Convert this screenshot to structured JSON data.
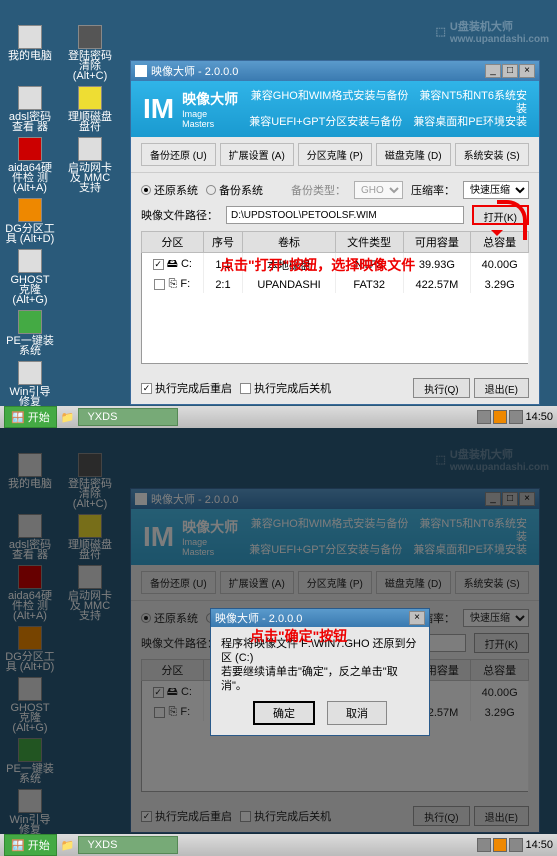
{
  "watermark": {
    "brand": "U盘装机大师",
    "url": "www.upandashi.com"
  },
  "desktop": {
    "icons": [
      [
        "我的电脑",
        "登陆密码清除\n(Alt+C)"
      ],
      [
        "adsl密码查看\n器",
        "理顺磁盘盘符"
      ],
      [
        "aida64硬件检\n测(Alt+A)",
        "启动网卡及\nMMC支持"
      ],
      [
        "DG分区工具\n(Alt+D)",
        ""
      ],
      [
        "GHOST克隆\n(Alt+G)",
        ""
      ],
      [
        "PE一键装系统",
        ""
      ],
      [
        "Win引导修复\n(Alt+W)",
        ""
      ]
    ]
  },
  "win": {
    "title": "映像大师 - 2.0.0.0",
    "brand_ch": "映像大师",
    "brand_en": "Image Masters",
    "tag1": "兼容GHO和WIM格式安装与备份",
    "tag2": "兼容UEFI+GPT分区安装与备份",
    "tag3": "兼容NT5和NT6系统安装",
    "tag4": "兼容桌面和PE环境安装",
    "tabs": [
      "备份还原 (U)",
      "扩展设置 (A)",
      "分区克隆 (P)",
      "磁盘克隆 (D)",
      "系统安装 (S)"
    ],
    "restore": "还原系统",
    "backup": "备份系统",
    "backup_type_lbl": "备份类型：",
    "backup_type_val": "GHO",
    "compress_lbl": "压缩率：",
    "compress_val": "快速压缩",
    "path_lbl": "映像文件路径：",
    "path_val": "D:\\UPDSTOOL\\PETOOLSF.WIM",
    "open_btn": "打开(K)",
    "headers": [
      "分区",
      "序号",
      "卷标",
      "文件类型",
      "可用容量",
      "总容量"
    ],
    "rows": [
      {
        "drive": "C:",
        "idx": "1:1",
        "vol": "本地磁盘",
        "fs": "NTFS",
        "free": "39.93G",
        "total": "40.00G",
        "checked": true,
        "icon": "hdd"
      },
      {
        "drive": "F:",
        "idx": "2:1",
        "vol": "UPANDASHI",
        "fs": "FAT32",
        "free": "422.57M",
        "total": "3.29G",
        "checked": false,
        "icon": "usb"
      }
    ],
    "chk_restart": "执行完成后重启",
    "chk_shutdown": "执行完成后关机",
    "exec_btn": "执行(Q)",
    "exit_btn": "退出(E)"
  },
  "taskbar": {
    "start": "开始",
    "task": "YXDS",
    "time": "14:50"
  },
  "annotation1": "点击\"打开\"按钮，选择映像文件",
  "dialog": {
    "title": "映像大师 - 2.0.0.0",
    "line1": "程序将映像文件 F:\\WIN7.GHO 还原到分区 (C:)",
    "line2": "若要继续请单击\"确定\"，反之单击\"取消\"。",
    "ok": "确定",
    "cancel": "取消"
  },
  "annotation2": "点击\"确定\"按钮",
  "s2_path": "",
  "chart_data": null
}
